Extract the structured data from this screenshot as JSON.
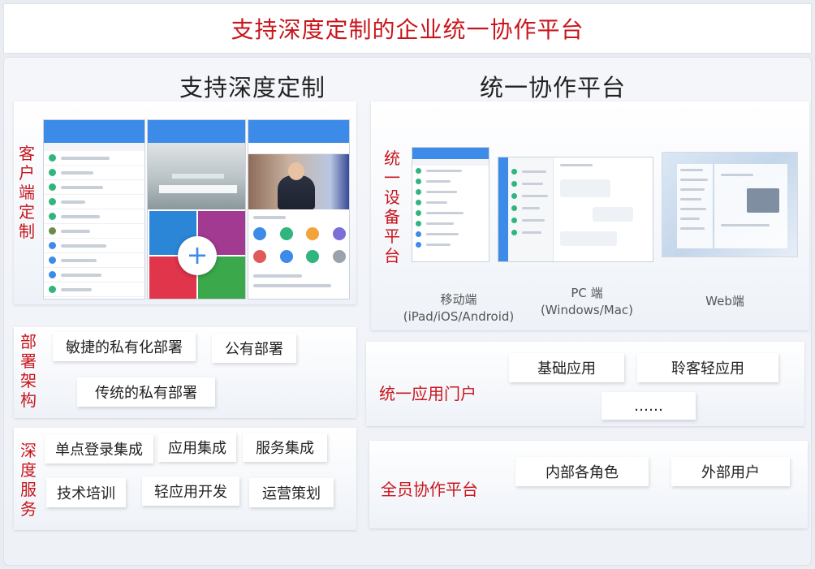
{
  "title": "支持深度定制的企业统一协作平台",
  "left": {
    "heading": "支持深度定制",
    "customer": {
      "label": "客户端定制"
    },
    "deploy": {
      "label": "部署架构",
      "chips": [
        "敏捷的私有化部署",
        "公有部署",
        "传统的私有部署"
      ]
    },
    "service": {
      "label": "深度服务",
      "chips": [
        "单点登录集成",
        "应用集成",
        "服务集成",
        "技术培训",
        "轻应用开发",
        "运营策划"
      ]
    }
  },
  "right": {
    "heading": "统一协作平台",
    "devices": {
      "label": "统一设备平台",
      "captions": {
        "mobile": "移动端\n(iPad/iOS/Android)",
        "pc": "PC 端\n(Windows/Mac)",
        "web": "Web端"
      }
    },
    "portal": {
      "label": "统一应用门户",
      "chips": [
        "基础应用",
        "聆客轻应用",
        "……"
      ]
    },
    "collab": {
      "label": "全员协作平台",
      "chips": [
        "内部各角色",
        "外部用户"
      ]
    }
  },
  "colors": {
    "accent": "#c8161d",
    "brand_blue": "#3d8be8",
    "green": "#2fb57d",
    "purple": "#a33a92",
    "red": "#e0354b"
  }
}
